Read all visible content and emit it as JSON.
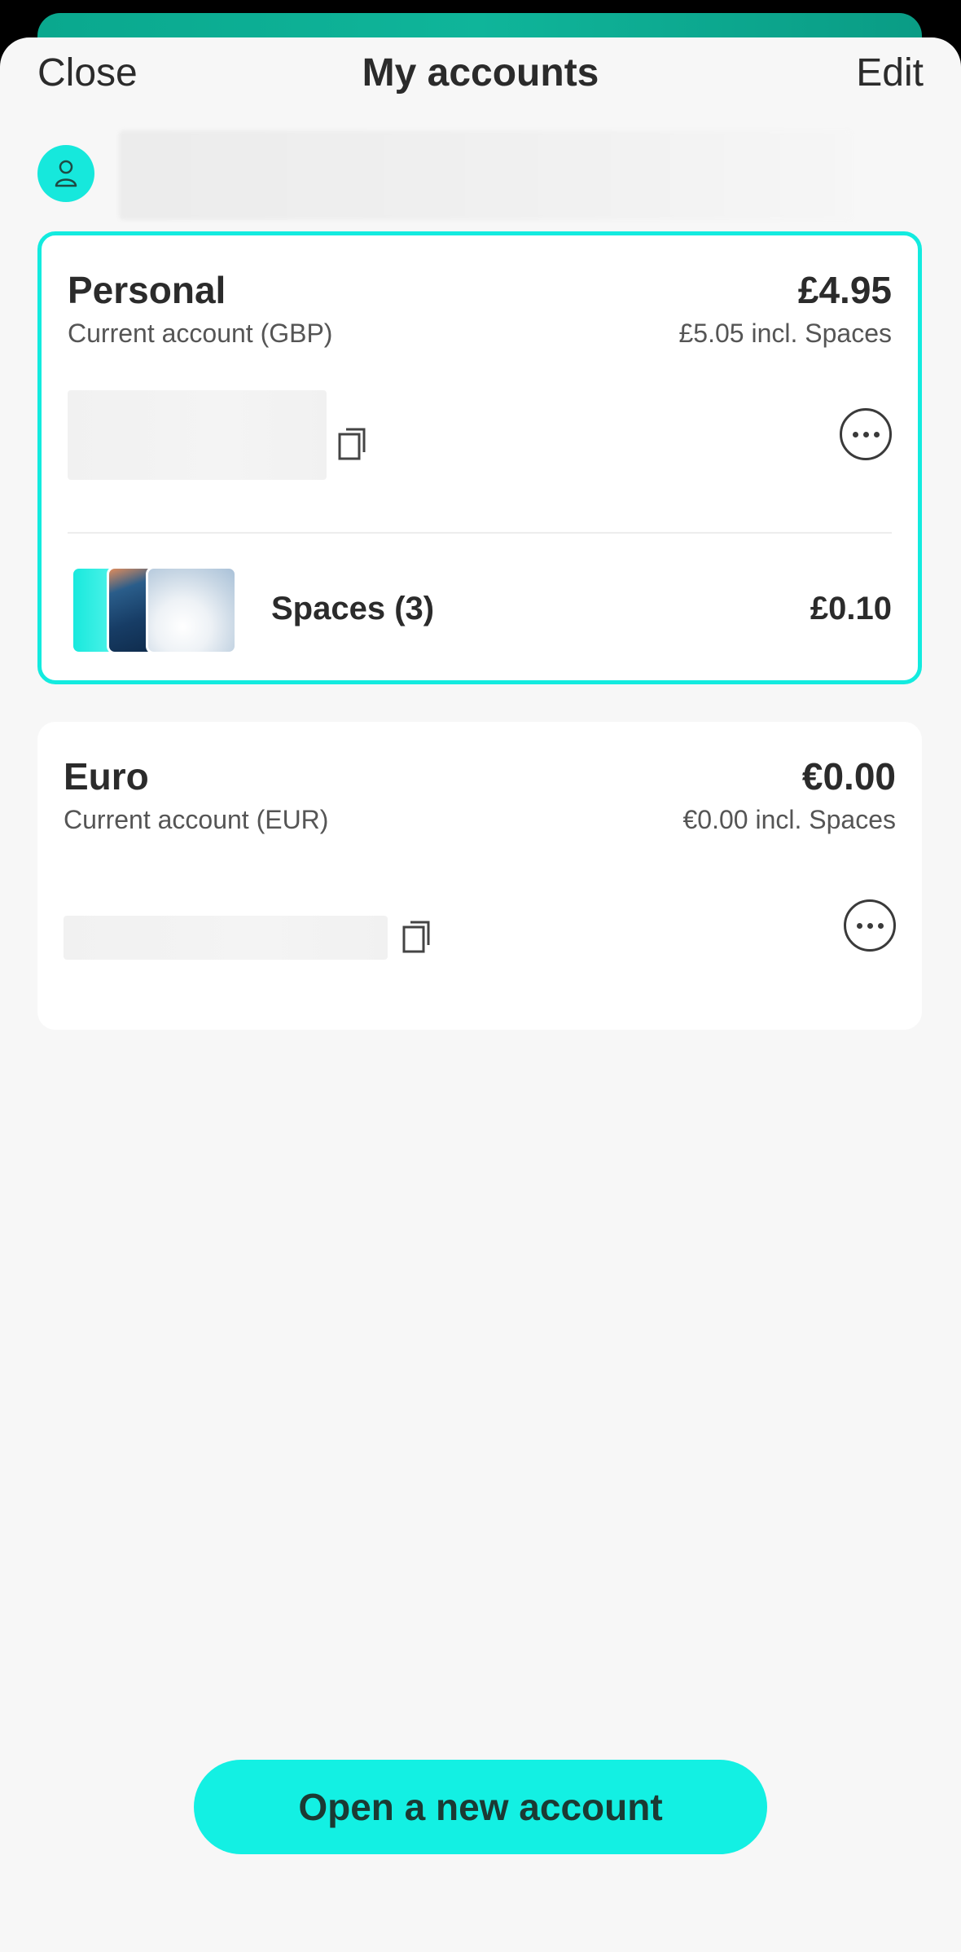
{
  "header": {
    "close_label": "Close",
    "title": "My accounts",
    "edit_label": "Edit"
  },
  "profile": {
    "avatar_icon": "person-icon"
  },
  "accounts": [
    {
      "name": "Personal",
      "type": "Current account (GBP)",
      "balance": "£4.95",
      "balance_incl_spaces": "£5.05 incl. Spaces",
      "spaces_label": "Spaces (3)",
      "spaces_amount": "£0.10",
      "selected": true
    },
    {
      "name": "Euro",
      "type": "Current account (EUR)",
      "balance": "€0.00",
      "balance_incl_spaces": "€0.00 incl. Spaces",
      "selected": false
    }
  ],
  "footer": {
    "open_account_label": "Open a new account"
  },
  "colors": {
    "accent": "#13f0e3",
    "selected_border": "#13ebdf",
    "header_strip": "#0fb59a"
  }
}
